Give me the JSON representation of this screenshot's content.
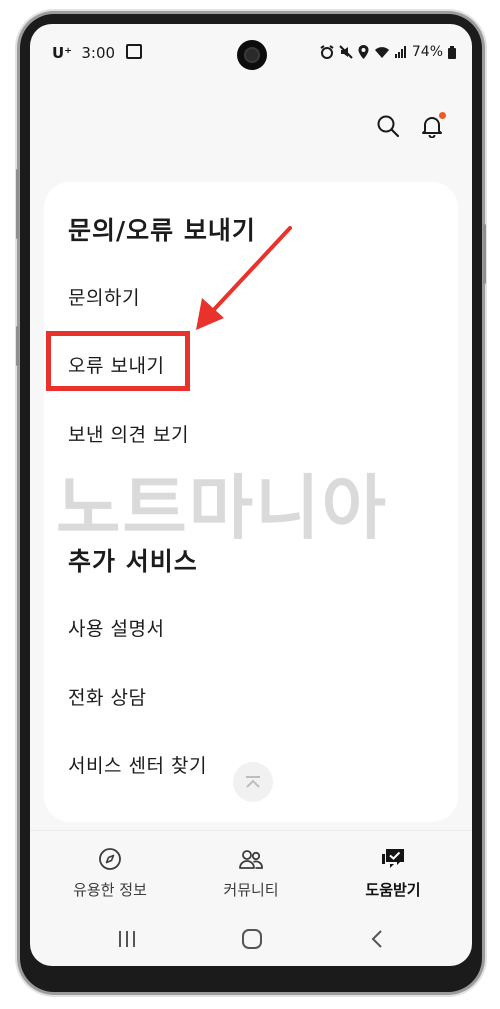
{
  "status_bar": {
    "carrier": "U⁺",
    "time": "3:00",
    "battery": "74%"
  },
  "header": {
    "search_icon": "search-icon",
    "bell_icon": "bell-icon",
    "notification_dot_color": "#f05a22"
  },
  "sections": [
    {
      "title": "문의/오류 보내기",
      "items": [
        "문의하기",
        "오류 보내기",
        "보낸 의견 보기"
      ]
    },
    {
      "title": "추가 서비스",
      "items": [
        "사용 설명서",
        "전화 상담",
        "서비스 센터 찾기"
      ]
    }
  ],
  "watermark": "노트마니아",
  "annotation": {
    "highlight_color": "#e8322b"
  },
  "bottom_nav": [
    {
      "label": "유용한 정보",
      "icon": "compass-icon",
      "active": false
    },
    {
      "label": "커뮤니티",
      "icon": "people-icon",
      "active": false
    },
    {
      "label": "도움받기",
      "icon": "chat-help-icon",
      "active": true
    }
  ],
  "system_nav": {
    "recents_icon": "recents-icon",
    "home_icon": "home-icon",
    "back_icon": "back-icon"
  }
}
